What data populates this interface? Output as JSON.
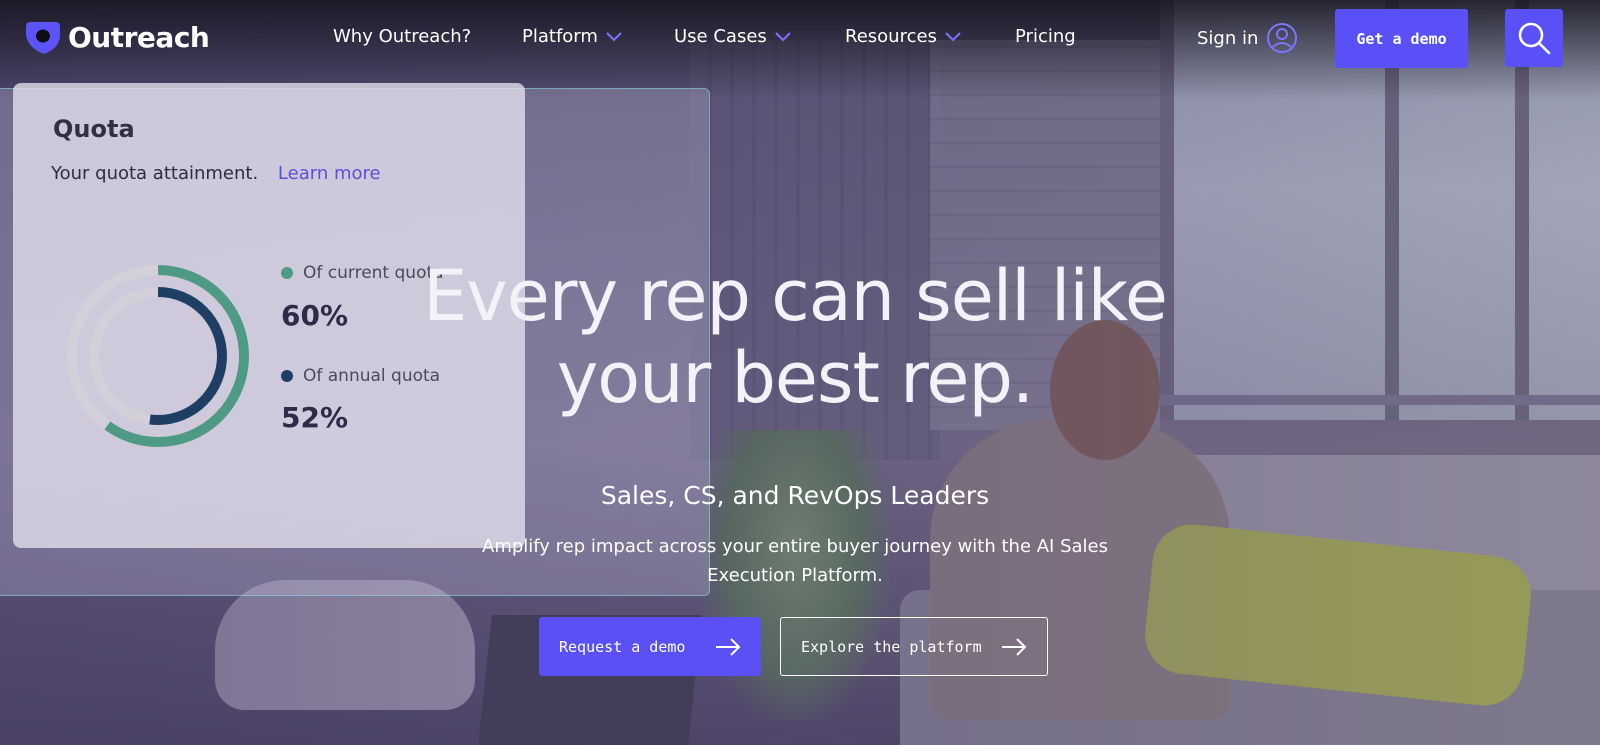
{
  "brand": {
    "name": "Outreach",
    "accent": "#5951f7"
  },
  "nav": {
    "items": [
      {
        "label": "Why Outreach?",
        "dropdown": false
      },
      {
        "label": "Platform",
        "dropdown": true
      },
      {
        "label": "Use Cases",
        "dropdown": true
      },
      {
        "label": "Resources",
        "dropdown": true
      },
      {
        "label": "Pricing",
        "dropdown": false
      }
    ],
    "sign_in": "Sign in",
    "get_demo": "Get a demo",
    "search_icon": "search-icon"
  },
  "quota_card": {
    "title": "Quota",
    "subtitle": "Your quota attainment.",
    "link": "Learn more",
    "legend": [
      {
        "label": "Of current quota",
        "value": "60%",
        "fraction": 0.6,
        "color": "#4f9a84"
      },
      {
        "label": "Of annual quota",
        "value": "52%",
        "fraction": 0.52,
        "color": "#1f3e63"
      }
    ]
  },
  "hero": {
    "title_line1": "Every rep can sell like",
    "title_line2": "your best rep.",
    "kicker": "Sales, CS, and RevOps Leaders",
    "description": "Amplify rep impact across your entire buyer journey with the AI Sales Execution Platform.",
    "cta_primary": "Request a demo",
    "cta_secondary": "Explore the platform"
  }
}
